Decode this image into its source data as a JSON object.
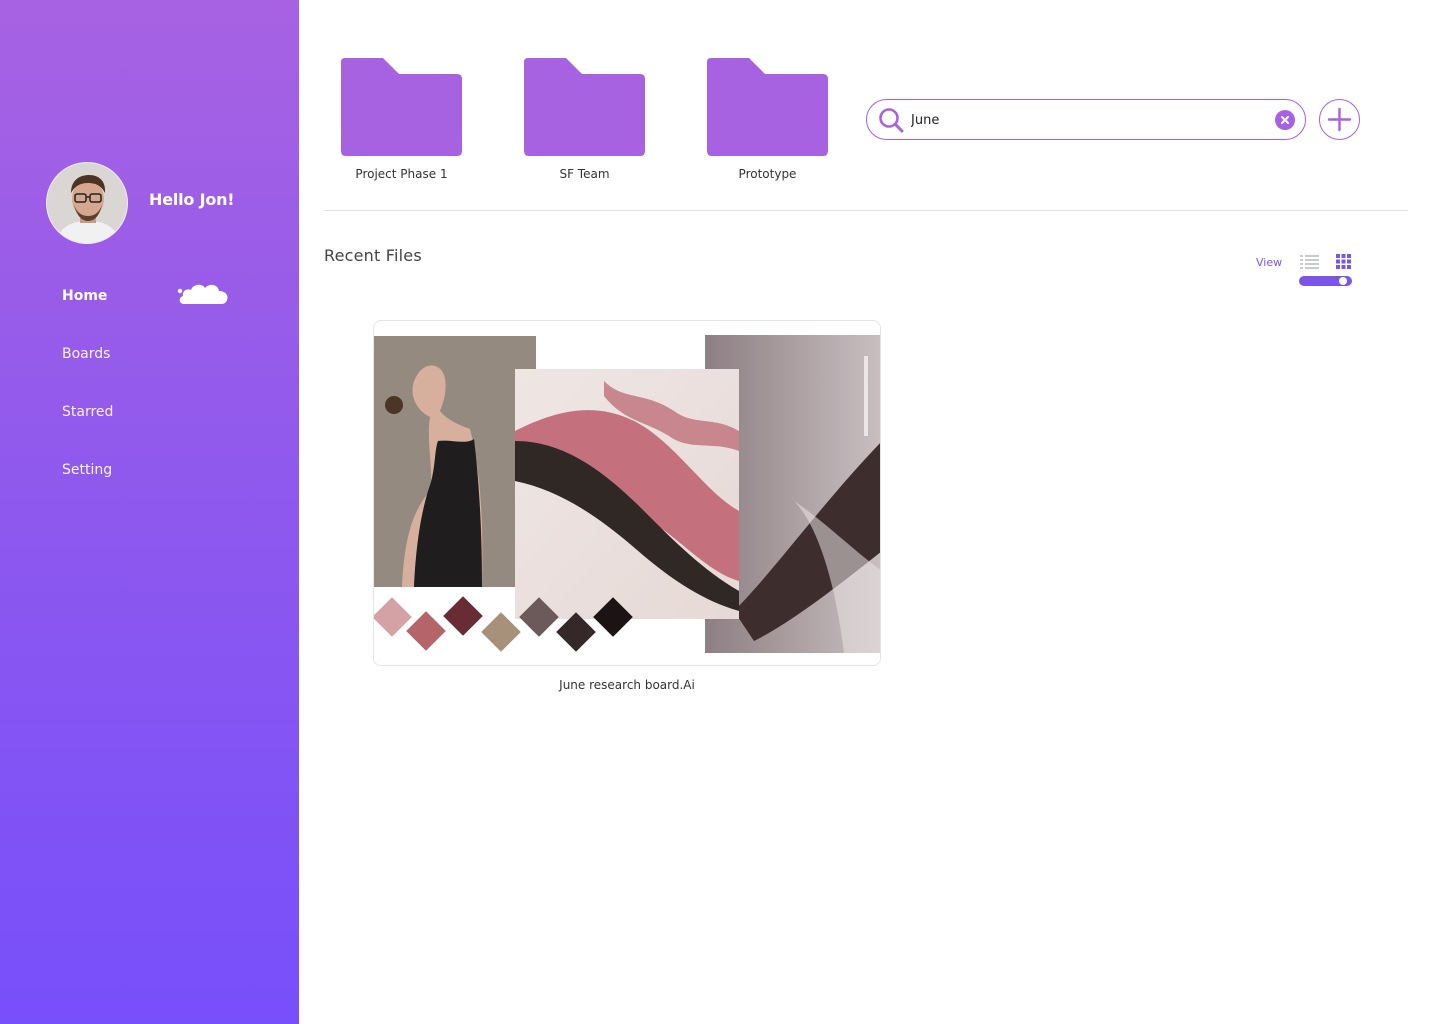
{
  "sidebar": {
    "greeting": "Hello Jon!",
    "items": [
      {
        "label": "Home",
        "active": true
      },
      {
        "label": "Boards",
        "active": false
      },
      {
        "label": "Starred",
        "active": false
      },
      {
        "label": "Setting",
        "active": false
      }
    ],
    "gradient": [
      "#a762e2",
      "#774ffb"
    ]
  },
  "folders": [
    {
      "label": "Project Phase 1",
      "icon": "folder-icon"
    },
    {
      "label": "SF Team",
      "icon": "folder-icon"
    },
    {
      "label": "Prototype",
      "icon": "folder-icon"
    }
  ],
  "search": {
    "value": "June",
    "icon": "search-icon"
  },
  "recent": {
    "title": "Recent Files",
    "view_label": "View",
    "view_mode": "grid",
    "files": [
      {
        "name": "June research board.Ai"
      }
    ]
  },
  "colors": {
    "accent": "#a762e2",
    "accent_dark": "#7a55e8",
    "swatches": [
      "#d4a2a5",
      "#b5646a",
      "#6a2c34",
      "#a8917b",
      "#6c5a5b",
      "#342828",
      "#1c1414"
    ]
  }
}
